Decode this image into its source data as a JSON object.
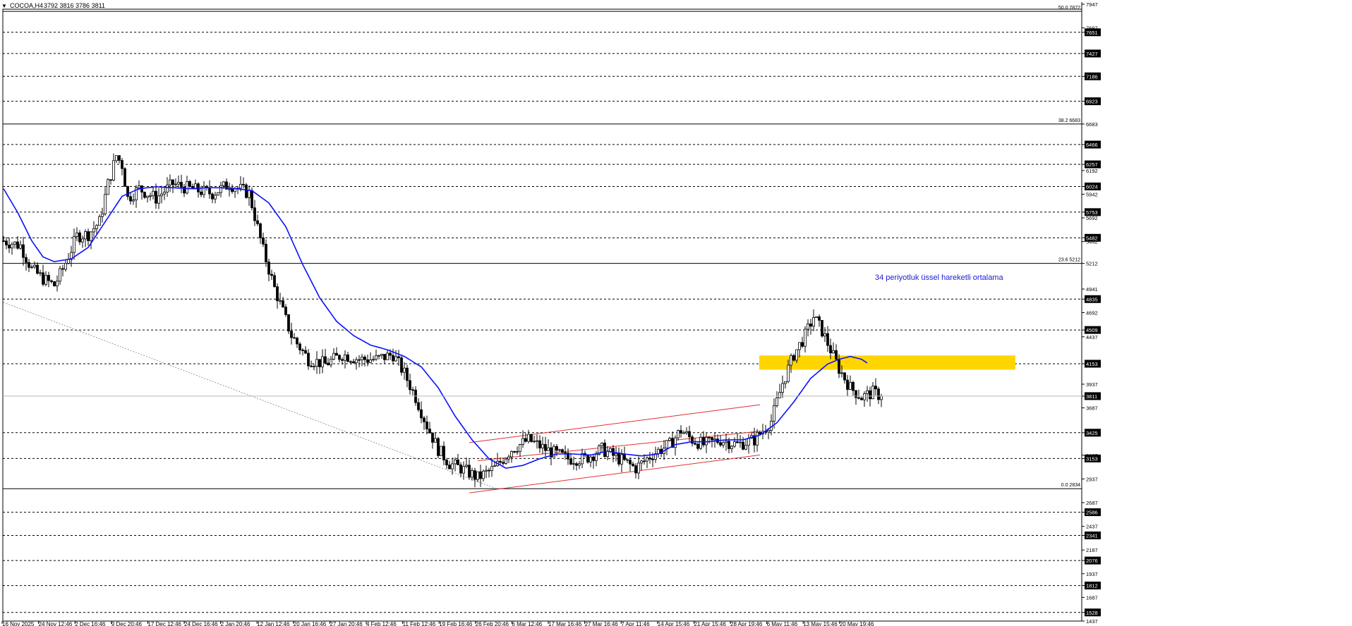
{
  "header": {
    "symbol": "COCOA,H4",
    "ohlc": "3792 3816 3786 3811"
  },
  "annotation_text": "34 periyotluk üssel hareketli ortalama",
  "chart_data": {
    "type": "candlestick",
    "ylim": [
      1437,
      7947
    ],
    "grid": false,
    "price_scale_labels": [
      7947,
      7697,
      7651,
      7427,
      7186,
      6923,
      6683,
      6466,
      6257,
      6192,
      6024,
      5942,
      5753,
      5692,
      5482,
      5442,
      5212,
      4941,
      4835,
      4692,
      4509,
      4437,
      4153,
      3937,
      3811,
      3687,
      3425,
      3187,
      3153,
      2937,
      2687,
      2586,
      2437,
      2341,
      2187,
      2076,
      1937,
      1812,
      1687,
      1528,
      1437
    ],
    "horizontal_levels": [
      7651,
      7427,
      7186,
      6923,
      6466,
      6257,
      6024,
      5753,
      5482,
      4835,
      4509,
      4153,
      3425,
      3153,
      2586,
      2341,
      2076,
      1812,
      1528
    ],
    "fibonacci": [
      {
        "label": "50.0 7872",
        "price": 7872
      },
      {
        "label": "38.2 6683",
        "price": 6683
      },
      {
        "label": "23.6 5212",
        "price": 5212
      },
      {
        "label": "0.0 2834",
        "price": 2834
      }
    ],
    "current_price": 3811,
    "x_tick_labels": [
      "16 Nov 2025",
      "24 Nov 12:46",
      "2 Dec 16:46",
      "9 Dec 20:46",
      "17 Dec 12:46",
      "24 Dec 16:46",
      "2 Jan 20:46",
      "12 Jan 12:46",
      "20 Jan 16:46",
      "27 Jan 20:46",
      "4 Feb 12:46",
      "11 Feb 12:46",
      "19 Feb 16:46",
      "26 Feb 20:46",
      "6 Mar 12:46",
      "17 Mar 16:46",
      "27 Mar 16:46",
      "7 Apr 11:46",
      "14 Apr 15:46",
      "21 Apr 15:46",
      "28 Apr 19:46",
      "6 May 11:46",
      "13 May 15:46",
      "20 May 19:46"
    ],
    "price_path": [
      [
        0,
        5450
      ],
      [
        6,
        5400
      ],
      [
        10,
        5150
      ],
      [
        14,
        5050
      ],
      [
        18,
        4980
      ],
      [
        21,
        5150
      ],
      [
        26,
        5500
      ],
      [
        30,
        5520
      ],
      [
        34,
        5650
      ],
      [
        37,
        6050
      ],
      [
        40,
        6350
      ],
      [
        42,
        6250
      ],
      [
        44,
        5900
      ],
      [
        48,
        6000
      ],
      [
        54,
        5900
      ],
      [
        60,
        6050
      ],
      [
        66,
        6000
      ],
      [
        74,
        5950
      ],
      [
        80,
        6050
      ],
      [
        87,
        5950
      ],
      [
        92,
        5350
      ],
      [
        96,
        4950
      ],
      [
        102,
        4450
      ],
      [
        108,
        4200
      ],
      [
        114,
        4150
      ],
      [
        120,
        4250
      ],
      [
        126,
        4200
      ],
      [
        132,
        4200
      ],
      [
        138,
        4250
      ],
      [
        142,
        4050
      ],
      [
        146,
        3800
      ],
      [
        150,
        3500
      ],
      [
        154,
        3250
      ],
      [
        158,
        3100
      ],
      [
        162,
        3050
      ],
      [
        168,
        2950
      ],
      [
        174,
        3050
      ],
      [
        180,
        3250
      ],
      [
        186,
        3350
      ],
      [
        192,
        3250
      ],
      [
        200,
        3150
      ],
      [
        206,
        3150
      ],
      [
        212,
        3250
      ],
      [
        218,
        3150
      ],
      [
        224,
        3050
      ],
      [
        230,
        3200
      ],
      [
        236,
        3300
      ],
      [
        240,
        3450
      ],
      [
        244,
        3350
      ],
      [
        248,
        3300
      ],
      [
        254,
        3350
      ],
      [
        260,
        3300
      ],
      [
        266,
        3350
      ],
      [
        272,
        3550
      ],
      [
        276,
        3950
      ],
      [
        280,
        4250
      ],
      [
        284,
        4450
      ],
      [
        287,
        4650
      ],
      [
        290,
        4500
      ],
      [
        293,
        4300
      ],
      [
        296,
        4100
      ],
      [
        300,
        3900
      ],
      [
        304,
        3800
      ],
      [
        308,
        3850
      ],
      [
        311,
        3811
      ]
    ],
    "ema_34": [
      [
        0,
        6000
      ],
      [
        5,
        5750
      ],
      [
        10,
        5450
      ],
      [
        14,
        5280
      ],
      [
        18,
        5230
      ],
      [
        24,
        5260
      ],
      [
        30,
        5380
      ],
      [
        36,
        5650
      ],
      [
        42,
        5920
      ],
      [
        48,
        6000
      ],
      [
        54,
        6020
      ],
      [
        60,
        6010
      ],
      [
        66,
        6000
      ],
      [
        72,
        6010
      ],
      [
        80,
        6010
      ],
      [
        88,
        5980
      ],
      [
        94,
        5850
      ],
      [
        100,
        5600
      ],
      [
        106,
        5200
      ],
      [
        112,
        4850
      ],
      [
        118,
        4600
      ],
      [
        124,
        4450
      ],
      [
        130,
        4350
      ],
      [
        136,
        4300
      ],
      [
        142,
        4230
      ],
      [
        148,
        4120
      ],
      [
        154,
        3900
      ],
      [
        160,
        3600
      ],
      [
        166,
        3350
      ],
      [
        172,
        3150
      ],
      [
        178,
        3050
      ],
      [
        184,
        3080
      ],
      [
        190,
        3150
      ],
      [
        196,
        3200
      ],
      [
        202,
        3200
      ],
      [
        208,
        3190
      ],
      [
        214,
        3230
      ],
      [
        220,
        3200
      ],
      [
        226,
        3180
      ],
      [
        232,
        3200
      ],
      [
        238,
        3300
      ],
      [
        244,
        3330
      ],
      [
        250,
        3330
      ],
      [
        256,
        3350
      ],
      [
        262,
        3350
      ],
      [
        268,
        3400
      ],
      [
        274,
        3530
      ],
      [
        280,
        3750
      ],
      [
        286,
        4000
      ],
      [
        292,
        4150
      ],
      [
        296,
        4200
      ],
      [
        300,
        4230
      ],
      [
        304,
        4200
      ],
      [
        306,
        4160
      ]
    ],
    "channel_lines": [
      {
        "from": [
          165,
          3320
        ],
        "to": [
          268,
          3720
        ]
      },
      {
        "from": [
          165,
          2790
        ],
        "to": [
          268,
          3190
        ]
      },
      {
        "from": [
          168,
          3130
        ],
        "to": [
          268,
          3440
        ]
      }
    ],
    "trend_line": {
      "from": [
        0,
        4800
      ],
      "to": [
        175,
        2830
      ]
    },
    "highlight_band": [
      4090,
      4240
    ]
  }
}
